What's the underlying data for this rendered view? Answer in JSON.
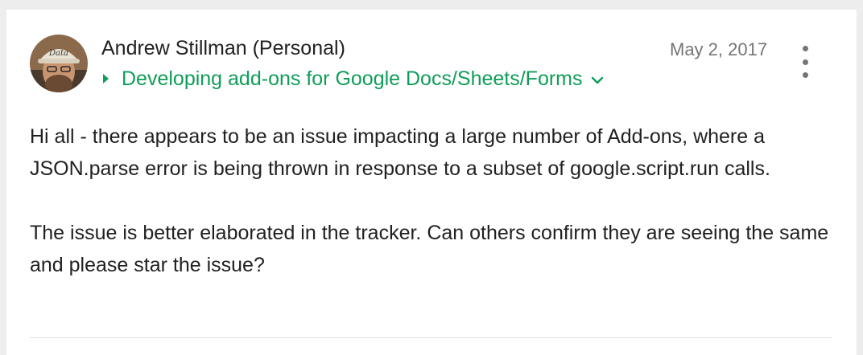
{
  "post": {
    "author": "Andrew Stillman (Personal)",
    "date": "May 2, 2017",
    "group": "Developing add-ons for Google Docs/Sheets/Forms",
    "avatar_icon": "user-avatar-photo",
    "more_icon": "more-vert-icon",
    "paragraphs": [
      "Hi all - there appears to be an issue impacting a large number of Add-ons, where a JSON.parse error is being thrown in response to a subset of google.script.run calls.",
      "The issue is better elaborated in the tracker.  Can others confirm they are seeing the same and please star the issue?"
    ]
  },
  "colors": {
    "group_link": "#0f9d58",
    "text": "#212121",
    "meta": "#757575",
    "background": "#ededed",
    "card": "#ffffff"
  }
}
